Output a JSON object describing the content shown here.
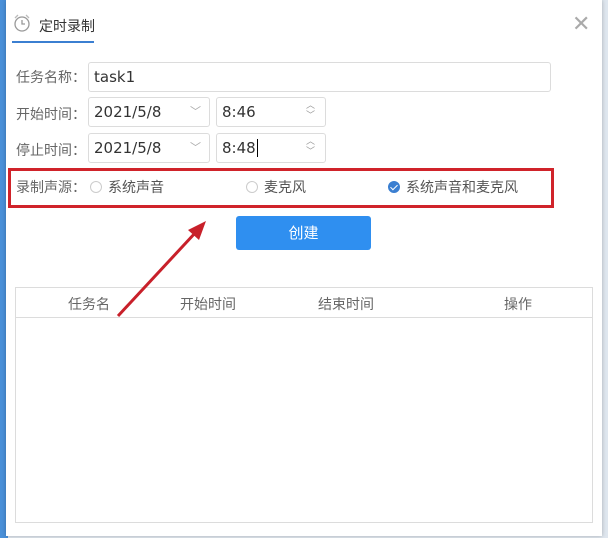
{
  "dialog": {
    "title": "定时录制",
    "close_icon": "close-icon",
    "clock_icon": "alarm-clock-icon"
  },
  "form": {
    "task_name_label": "任务名称：",
    "task_name_value": "task1",
    "start_label": "开始时间：",
    "start_date": "2021/5/8",
    "start_time": "8:46",
    "stop_label": "停止时间：",
    "stop_date": "2021/5/8",
    "stop_time": "8:48",
    "source_label": "录制声源：",
    "sources": [
      {
        "label": "系统声音",
        "checked": false
      },
      {
        "label": "麦克风",
        "checked": false
      },
      {
        "label": "系统声音和麦克风",
        "checked": true
      }
    ]
  },
  "create_button": "创建",
  "table": {
    "columns": [
      "任务名",
      "开始时间",
      "结束时间",
      "操作"
    ],
    "rows": []
  },
  "colors": {
    "accent": "#2f8ff0",
    "highlight": "#d0232a"
  }
}
